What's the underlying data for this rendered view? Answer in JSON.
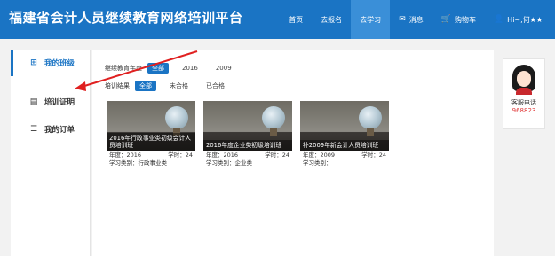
{
  "header": {
    "title": "福建省会计人员继续教育网络培训平台",
    "nav": [
      {
        "label": "首页",
        "icon": ""
      },
      {
        "label": "去报名",
        "icon": ""
      },
      {
        "label": "去学习",
        "icon": "",
        "active": true
      },
      {
        "label": "消息",
        "icon": "mail-icon"
      },
      {
        "label": "购物车",
        "icon": "cart-icon"
      },
      {
        "label": "Hi~,何★★",
        "icon": "user-icon"
      }
    ]
  },
  "sidebar": {
    "items": [
      {
        "label": "我的班级",
        "icon": "grid-icon",
        "active": true
      },
      {
        "label": "培训证明",
        "icon": "certificate-icon"
      },
      {
        "label": "我的订单",
        "icon": "list-icon"
      }
    ]
  },
  "filters": {
    "year": {
      "label": "继续教育年度",
      "options": [
        "全部",
        "2016",
        "2009"
      ],
      "selected": "全部"
    },
    "result": {
      "label": "培训结果",
      "options": [
        "全部",
        "未合格",
        "已合格"
      ],
      "selected": "全部"
    }
  },
  "courses": [
    {
      "title": "2016年行政事业类初级会计人员培训班",
      "year_label": "年度：2016",
      "hours_label": "学时：24",
      "category_label": "学习类别：行政事业类"
    },
    {
      "title": "2016年度企业类初级培训班",
      "year_label": "年度：2016",
      "hours_label": "学时：24",
      "category_label": "学习类别：企业类"
    },
    {
      "title": "补2009年新会计人员培训班",
      "year_label": "年度：2009",
      "hours_label": "学时：24",
      "category_label": "学习类别："
    }
  ],
  "support": {
    "label": "客服电话",
    "phone": "968823"
  },
  "colors": {
    "primary": "#1a74c4",
    "accent_red": "#e03a3a",
    "annotation_arrow": "#e02020"
  }
}
